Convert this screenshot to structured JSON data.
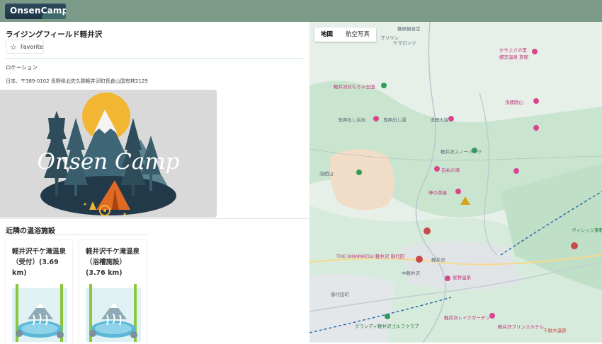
{
  "header": {
    "logo_text": "OnsenCamp"
  },
  "place": {
    "title": "ライジングフィールド軽井沢",
    "favorite_label": "Favorite",
    "location_label": "ロケーション",
    "address": "日本、〒389-0102 長野県北佐久郡軽井沢町長倉山国有林2129"
  },
  "hero": {
    "logo_text": "Onsen Camp"
  },
  "nearby": {
    "title": "近隣の温浴施設",
    "items": [
      {
        "name": "軽井沢千ケ滝温泉（受付）(3.69 km)"
      },
      {
        "name": "軽井沢千ケ滝温泉（浴槽施設）(3.76 km)"
      }
    ]
  },
  "map": {
    "tabs": [
      "地図",
      "航空写真"
    ],
    "labels": [
      "ヤマロッジ",
      "鎌原観音堂",
      "ブリウン",
      "かや上さの里",
      "嬬恋温泉 旅館",
      "軽井沢おもちゃ王国",
      "浅間隠山",
      "鬼押出し園",
      "鬼押出し浴池",
      "浅間大滝",
      "浅間山",
      "軽井沢スノーパーク",
      "白糸の滝",
      "峰の茶屋",
      "THE HIRAMATSU 軽井沢 御代田",
      "軽井沢",
      "中軽井沢",
      "星野温泉",
      "グランディ軽井沢ゴルフクラブ",
      "軽井沢レイクガーデン",
      "軽井沢プリンスホテル",
      "ヴィレッジ東軽井沢ゴルフクラブ",
      "千駄木遺跡",
      "御代田町"
    ]
  },
  "colors": {
    "header_bg": "#7c9a88",
    "map_bg": "#e6f0e9",
    "accent_line": "#cfe9e6",
    "poi_pink": "#d9468f",
    "poi_green": "#2f9c5a"
  }
}
